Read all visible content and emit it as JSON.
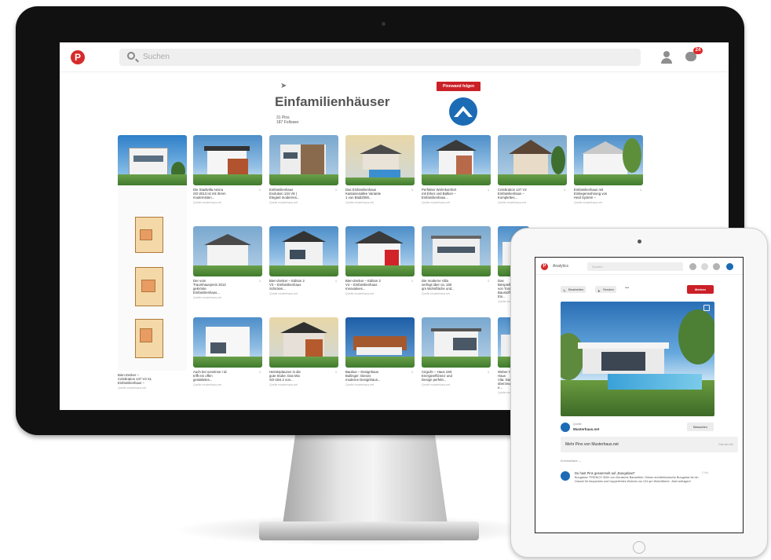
{
  "desktop": {
    "topbar": {
      "logo_glyph": "P",
      "search_placeholder": "Suchen",
      "notification_count": "24"
    },
    "board": {
      "title": "Einfamilienhäuser",
      "pins": "31 Pins",
      "followers": "187 Follower",
      "follow_label": "Pinnwand folgen"
    },
    "pins": [
      {
        "desc": "Die Stadtvilla Amica\nSO-2013 ist mit ihrem\nmodernisten...",
        "src": "Quelle\nmusterhaus.net",
        "count": "1"
      },
      {
        "desc": "Einfamilienhaus\nEvolution 134 V8 |\nElegant modernes...",
        "src": "Quelle\nmusterhaus.net",
        "count": "1"
      },
      {
        "desc": "Das Einfamilienhaus\nKastanienallee Variante\n1 von Büdi2000...",
        "src": "Quelle\nmusterhaus.net",
        "count": "1"
      },
      {
        "desc": "Perfekter Wohnkomfort\nmit Erker und Balkon –\nEinfamilienhaus...",
        "src": "Quelle\nmusterhaus.net",
        "count": "1"
      },
      {
        "desc": "Celebration 137 V2\nEinfamilienhaus –\nKomplettes...",
        "src": "Quelle\nmusterhaus.net",
        "count": "1"
      },
      {
        "desc": "Einfamilienhaus mit\nEinliegerwohnung von\nHeid System –",
        "src": "Quelle\nmusterhaus.net",
        "count": "1"
      },
      {
        "desc": "Der vom\nTraumhauspreis 2013\ngekrönte\nEinfamilienhaus...",
        "src": "Quelle\nmusterhaus.net",
        "count": "1"
      },
      {
        "desc": "Bien-Zenker – Edition 2\nV3 – Einfamilienhaus\nSchickes...",
        "src": "Quelle\nmusterhaus.net",
        "count": "1"
      },
      {
        "desc": "Bien-Zenker – Edition 2\nV4 – Einfamilienhaus\nInnovatives...",
        "src": "Quelle\nmusterhaus.net",
        "count": "1"
      },
      {
        "desc": "Die moderne Villa\nverfügt über ca. 160\nqm Wohnfläche und...",
        "src": "Quelle\nmusterhaus.net",
        "count": "1"
      },
      {
        "desc": "Das Beispielhaus\nvon Tonig\nBaustoffstab. Ein...",
        "src": "Quelle\nmusterhaus.net",
        "count": "1"
      },
      {
        "desc": "Auch bei sonnlnne I td\ntrifft ein offen\ngestaltetes...",
        "src": "Quelle\nmusterhaus.net",
        "count": "1"
      },
      {
        "desc": "Heimtsplauzen in die\ngute Stube: Das Mio\nSO-15S.2 von...",
        "src": "Quelle\nmusterhaus.net",
        "count": "1"
      },
      {
        "desc": "Bauhus – Designhaus\nBullinger: Dieses\nmoderne Designhaus...",
        "src": "Quelle\nmusterhaus.net",
        "count": "1"
      },
      {
        "desc": "CirgLife – Haus 150:\nEnergieeffizienz und\nDesign perfekt...",
        "src": "Quelle\nmusterhaus.net",
        "count": "1"
      },
      {
        "desc": "Weber Haus – Haus\nVita: Das Haus\nüberzeugt, dies n...",
        "src": "Quelle\nmusterhaus.net",
        "count": "1"
      }
    ],
    "plan_pin": {
      "desc": "Bien-Zenker –\nCelebration 137 V3 XL\nEinfamilienhaus –",
      "src": "Quelle\nmusterhaus.net",
      "count": "1"
    }
  },
  "tablet": {
    "topbar": {
      "logo_glyph": "P",
      "app_label": "Analytics",
      "search_placeholder": "Suchen"
    },
    "actions": {
      "edit_label": "Bearbeiten",
      "send_label": "Senden",
      "more_label": "•••",
      "save_label": "Merken"
    },
    "source": {
      "label": "Quelle:",
      "name": "Musterhaus.net",
      "visit_label": "Besuchen"
    },
    "more_pins": {
      "text": "Mehr Pins von Musterhaus.net",
      "link": "Das bin ich!"
    },
    "comments_label": "Kommentare ⌄",
    "comment": {
      "head": "Du hast Pins gesammelt auf „Bungalows\"",
      "text": "Bungalow \"FRENCH 3000 von Deutsche Bauweltler. Dieser architektonische Bungalow ist ein Garant für bequemes und hopperfreies Wohnen au 124 qm Wohnfläche. Jetzt anfragen!",
      "time": "2 Wo."
    }
  }
}
